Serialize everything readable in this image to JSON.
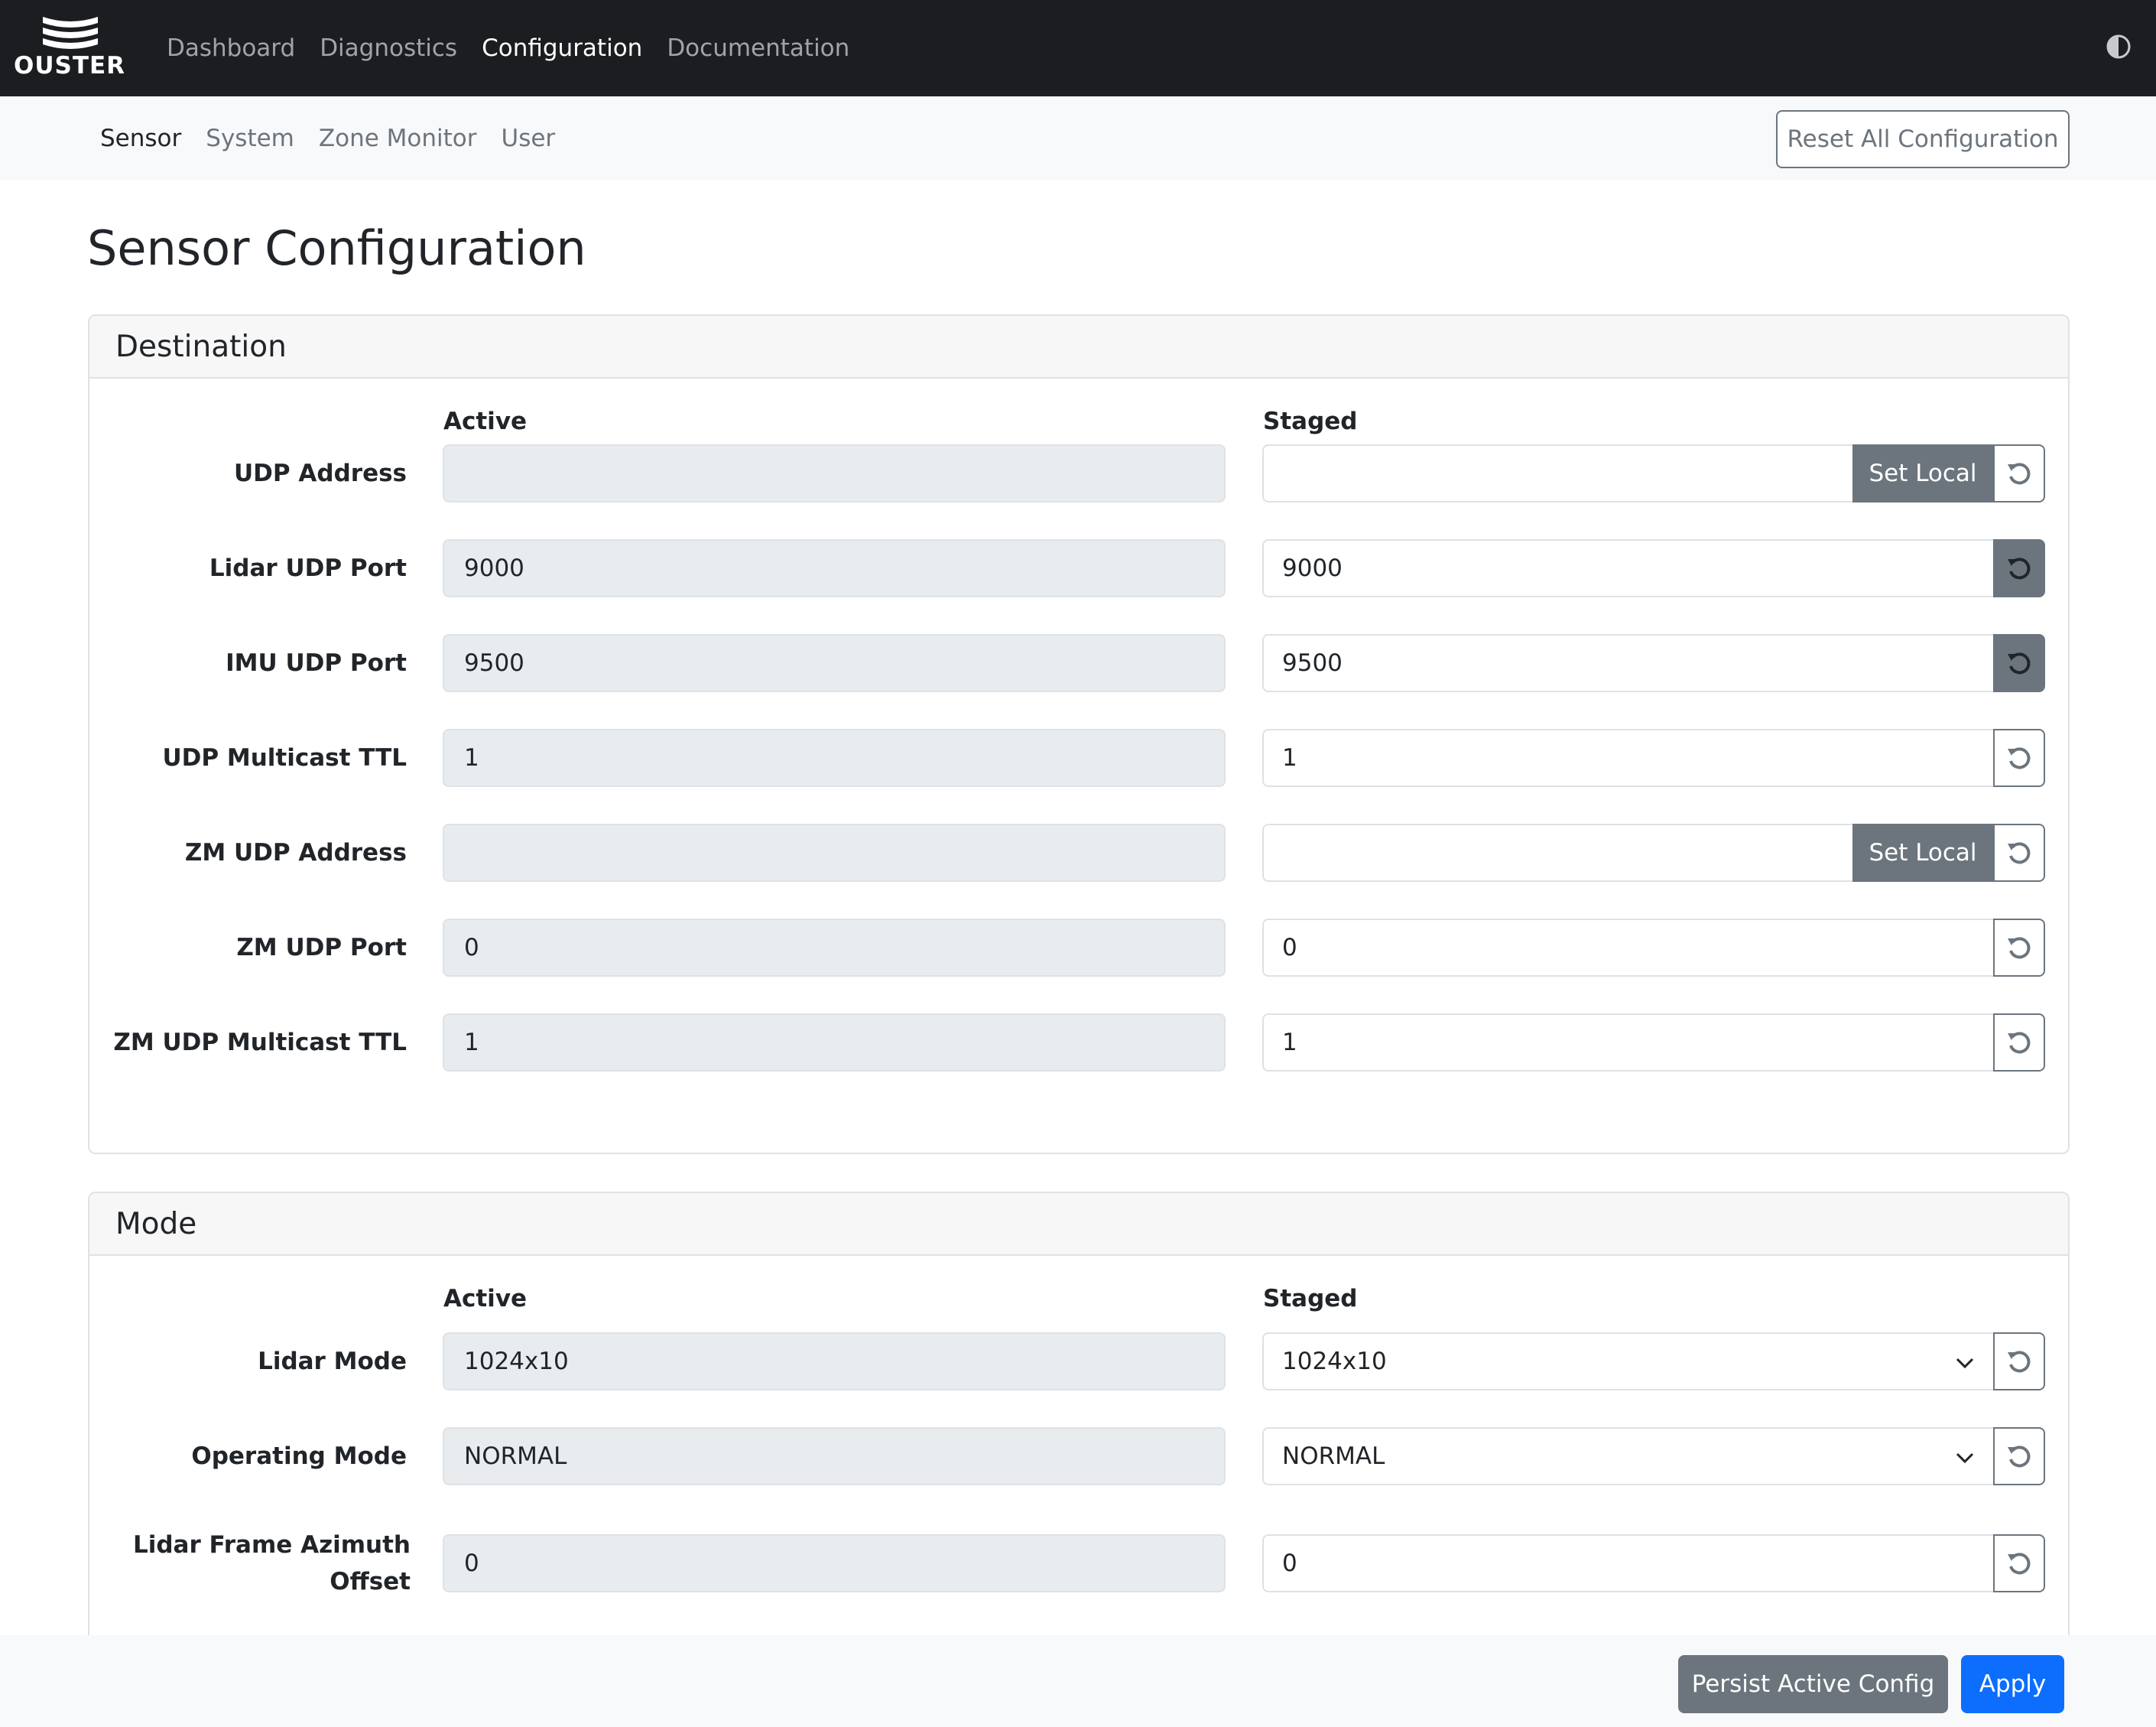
{
  "brand": {
    "name": "OUSTER",
    "icon": "ouster-logo-icon"
  },
  "nav": {
    "items": [
      {
        "label": "Dashboard",
        "active": false
      },
      {
        "label": "Diagnostics",
        "active": false
      },
      {
        "label": "Configuration",
        "active": true
      },
      {
        "label": "Documentation",
        "active": false
      }
    ],
    "theme_icon": "contrast-icon"
  },
  "subnav": {
    "items": [
      {
        "label": "Sensor",
        "active": true
      },
      {
        "label": "System",
        "active": false
      },
      {
        "label": "Zone Monitor",
        "active": false
      },
      {
        "label": "User",
        "active": false
      }
    ],
    "reset_all_label": "Reset All Configuration"
  },
  "page": {
    "title": "Sensor Configuration"
  },
  "destination": {
    "title": "Destination",
    "active_header": "Active",
    "staged_header": "Staged",
    "rows": [
      {
        "label": "UDP Address",
        "active": "",
        "staged": "",
        "set_local": "Set Local"
      },
      {
        "label": "Lidar UDP Port",
        "active": "9000",
        "staged": "9000"
      },
      {
        "label": "IMU UDP Port",
        "active": "9500",
        "staged": "9500"
      },
      {
        "label": "UDP Multicast TTL",
        "active": "1",
        "staged": "1"
      },
      {
        "label": "ZM UDP Address",
        "active": "",
        "staged": "",
        "set_local": "Set Local"
      },
      {
        "label": "ZM UDP Port",
        "active": "0",
        "staged": "0"
      },
      {
        "label": "ZM UDP Multicast TTL",
        "active": "1",
        "staged": "1"
      }
    ]
  },
  "mode": {
    "title": "Mode",
    "active_header": "Active",
    "staged_header": "Staged",
    "rows": [
      {
        "label": "Lidar Mode",
        "active": "1024x10",
        "staged": "1024x10"
      },
      {
        "label": "Operating Mode",
        "active": "NORMAL",
        "staged": "NORMAL"
      },
      {
        "label": "Lidar Frame Azimuth Offset",
        "active": "0",
        "staged": "0"
      }
    ]
  },
  "footer": {
    "persist_label": "Persist Active Config",
    "apply_label": "Apply"
  },
  "colors": {
    "navbar": "#1c1d21",
    "secondary": "#6c757d",
    "primary": "#0d6efd",
    "readonly_bg": "#e9ecef"
  },
  "icons": {
    "reset": "reset-icon",
    "chevron": "chevron-down-icon"
  }
}
